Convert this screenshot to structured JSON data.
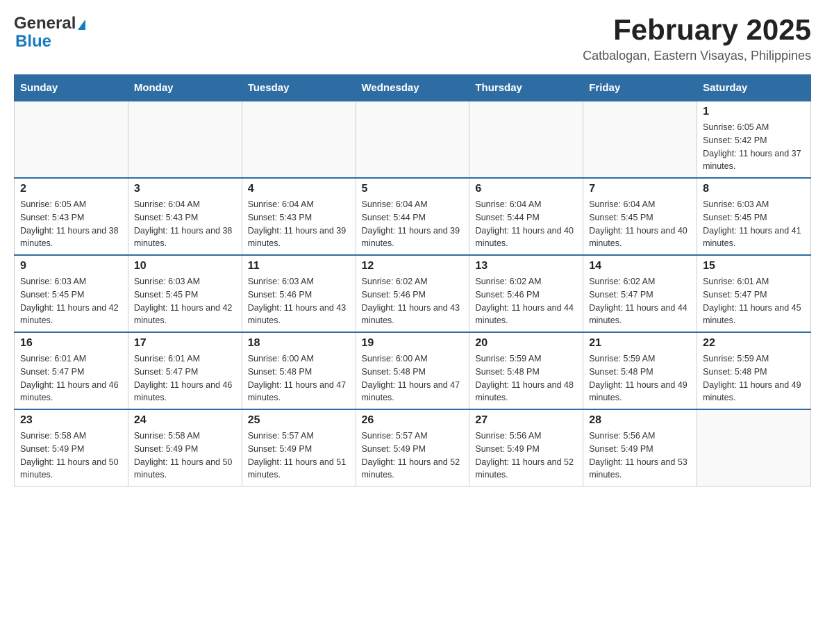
{
  "logo": {
    "general_text": "General",
    "blue_text": "Blue"
  },
  "header": {
    "title": "February 2025",
    "location": "Catbalogan, Eastern Visayas, Philippines"
  },
  "days_of_week": [
    "Sunday",
    "Monday",
    "Tuesday",
    "Wednesday",
    "Thursday",
    "Friday",
    "Saturday"
  ],
  "weeks": [
    {
      "days": [
        {
          "date": "",
          "info": ""
        },
        {
          "date": "",
          "info": ""
        },
        {
          "date": "",
          "info": ""
        },
        {
          "date": "",
          "info": ""
        },
        {
          "date": "",
          "info": ""
        },
        {
          "date": "",
          "info": ""
        },
        {
          "date": "1",
          "info": "Sunrise: 6:05 AM\nSunset: 5:42 PM\nDaylight: 11 hours and 37 minutes."
        }
      ]
    },
    {
      "days": [
        {
          "date": "2",
          "info": "Sunrise: 6:05 AM\nSunset: 5:43 PM\nDaylight: 11 hours and 38 minutes."
        },
        {
          "date": "3",
          "info": "Sunrise: 6:04 AM\nSunset: 5:43 PM\nDaylight: 11 hours and 38 minutes."
        },
        {
          "date": "4",
          "info": "Sunrise: 6:04 AM\nSunset: 5:43 PM\nDaylight: 11 hours and 39 minutes."
        },
        {
          "date": "5",
          "info": "Sunrise: 6:04 AM\nSunset: 5:44 PM\nDaylight: 11 hours and 39 minutes."
        },
        {
          "date": "6",
          "info": "Sunrise: 6:04 AM\nSunset: 5:44 PM\nDaylight: 11 hours and 40 minutes."
        },
        {
          "date": "7",
          "info": "Sunrise: 6:04 AM\nSunset: 5:45 PM\nDaylight: 11 hours and 40 minutes."
        },
        {
          "date": "8",
          "info": "Sunrise: 6:03 AM\nSunset: 5:45 PM\nDaylight: 11 hours and 41 minutes."
        }
      ]
    },
    {
      "days": [
        {
          "date": "9",
          "info": "Sunrise: 6:03 AM\nSunset: 5:45 PM\nDaylight: 11 hours and 42 minutes."
        },
        {
          "date": "10",
          "info": "Sunrise: 6:03 AM\nSunset: 5:45 PM\nDaylight: 11 hours and 42 minutes."
        },
        {
          "date": "11",
          "info": "Sunrise: 6:03 AM\nSunset: 5:46 PM\nDaylight: 11 hours and 43 minutes."
        },
        {
          "date": "12",
          "info": "Sunrise: 6:02 AM\nSunset: 5:46 PM\nDaylight: 11 hours and 43 minutes."
        },
        {
          "date": "13",
          "info": "Sunrise: 6:02 AM\nSunset: 5:46 PM\nDaylight: 11 hours and 44 minutes."
        },
        {
          "date": "14",
          "info": "Sunrise: 6:02 AM\nSunset: 5:47 PM\nDaylight: 11 hours and 44 minutes."
        },
        {
          "date": "15",
          "info": "Sunrise: 6:01 AM\nSunset: 5:47 PM\nDaylight: 11 hours and 45 minutes."
        }
      ]
    },
    {
      "days": [
        {
          "date": "16",
          "info": "Sunrise: 6:01 AM\nSunset: 5:47 PM\nDaylight: 11 hours and 46 minutes."
        },
        {
          "date": "17",
          "info": "Sunrise: 6:01 AM\nSunset: 5:47 PM\nDaylight: 11 hours and 46 minutes."
        },
        {
          "date": "18",
          "info": "Sunrise: 6:00 AM\nSunset: 5:48 PM\nDaylight: 11 hours and 47 minutes."
        },
        {
          "date": "19",
          "info": "Sunrise: 6:00 AM\nSunset: 5:48 PM\nDaylight: 11 hours and 47 minutes."
        },
        {
          "date": "20",
          "info": "Sunrise: 5:59 AM\nSunset: 5:48 PM\nDaylight: 11 hours and 48 minutes."
        },
        {
          "date": "21",
          "info": "Sunrise: 5:59 AM\nSunset: 5:48 PM\nDaylight: 11 hours and 49 minutes."
        },
        {
          "date": "22",
          "info": "Sunrise: 5:59 AM\nSunset: 5:48 PM\nDaylight: 11 hours and 49 minutes."
        }
      ]
    },
    {
      "days": [
        {
          "date": "23",
          "info": "Sunrise: 5:58 AM\nSunset: 5:49 PM\nDaylight: 11 hours and 50 minutes."
        },
        {
          "date": "24",
          "info": "Sunrise: 5:58 AM\nSunset: 5:49 PM\nDaylight: 11 hours and 50 minutes."
        },
        {
          "date": "25",
          "info": "Sunrise: 5:57 AM\nSunset: 5:49 PM\nDaylight: 11 hours and 51 minutes."
        },
        {
          "date": "26",
          "info": "Sunrise: 5:57 AM\nSunset: 5:49 PM\nDaylight: 11 hours and 52 minutes."
        },
        {
          "date": "27",
          "info": "Sunrise: 5:56 AM\nSunset: 5:49 PM\nDaylight: 11 hours and 52 minutes."
        },
        {
          "date": "28",
          "info": "Sunrise: 5:56 AM\nSunset: 5:49 PM\nDaylight: 11 hours and 53 minutes."
        },
        {
          "date": "",
          "info": ""
        }
      ]
    }
  ]
}
